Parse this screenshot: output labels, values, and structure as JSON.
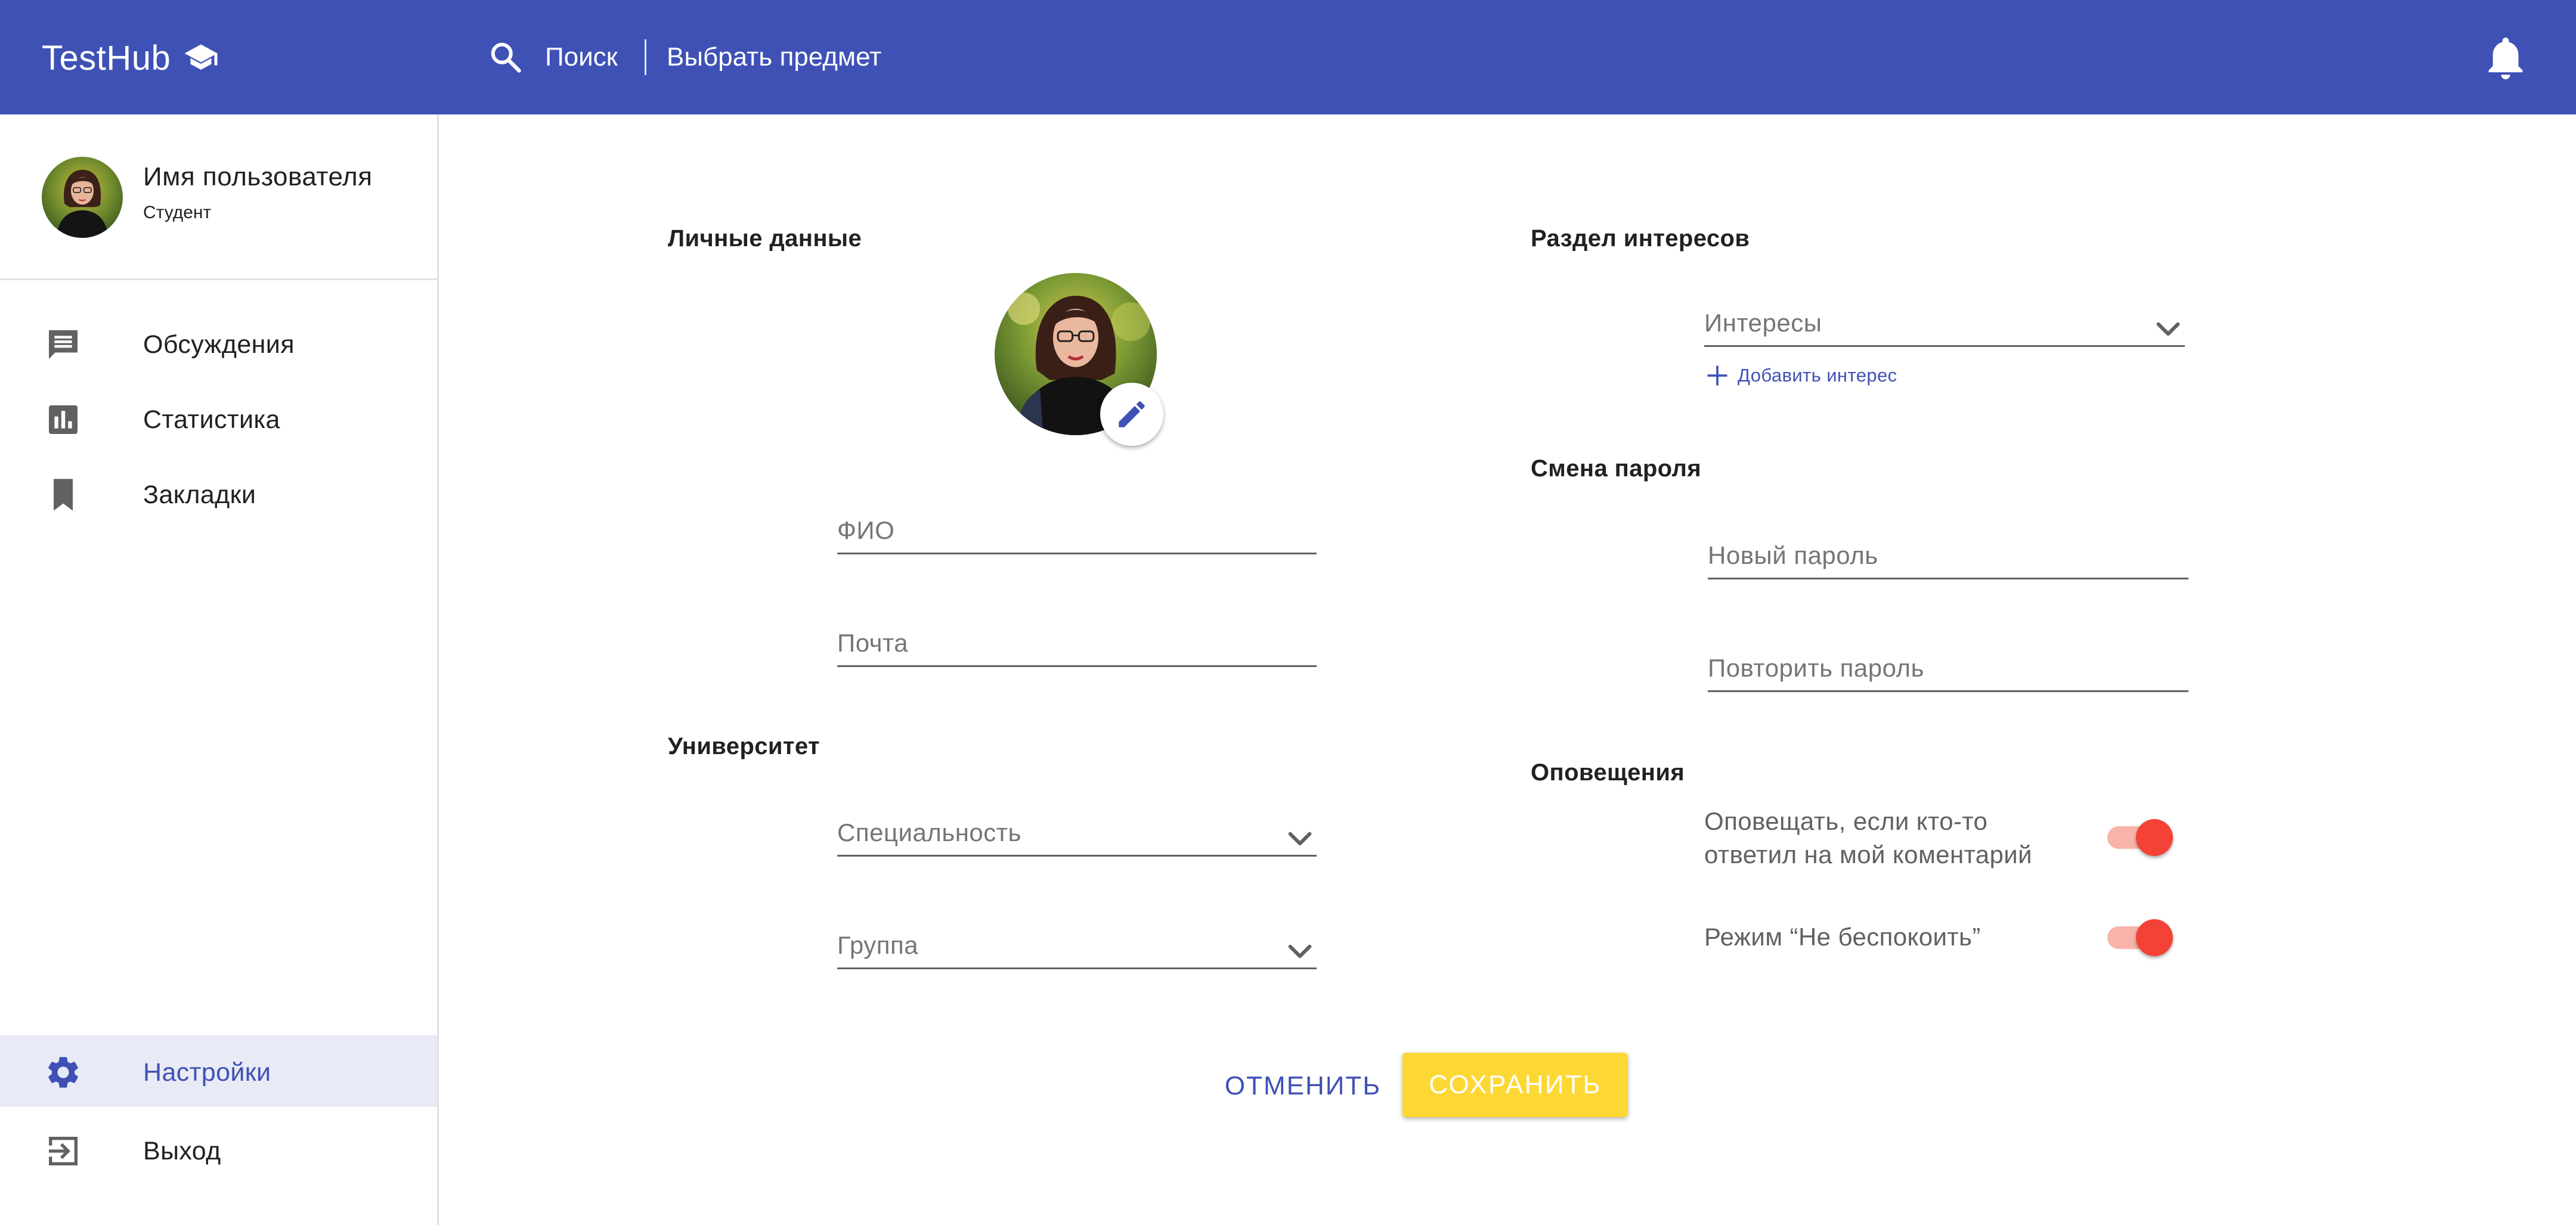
{
  "app": {
    "brand": "TestHub",
    "brand_icon": "graduation-cap-icon",
    "accent_color": "#3f51b5"
  },
  "topbar": {
    "search_label": "Поиск",
    "subject_label": "Выбрать предмет",
    "notifications_icon": "bell-icon"
  },
  "profile": {
    "name": "Имя пользователя",
    "role": "Студент"
  },
  "sidebar": {
    "items": [
      {
        "label": "Обсуждения",
        "icon": "chat-icon"
      },
      {
        "label": "Статистика",
        "icon": "bar-chart-icon"
      },
      {
        "label": "Закладки",
        "icon": "bookmark-icon"
      }
    ],
    "bottom_items": [
      {
        "label": "Настройки",
        "icon": "gear-icon",
        "active": true
      },
      {
        "label": "Выход",
        "icon": "logout-icon"
      }
    ]
  },
  "personal": {
    "title": "Личные данные",
    "fio_label": "ФИО",
    "email_label": "Почта"
  },
  "university": {
    "title": "Университет",
    "specialty_label": "Специальность",
    "group_label": "Группа"
  },
  "interests": {
    "title": "Раздел интересов",
    "select_label": "Интересы",
    "add_label": "Добавить интерес"
  },
  "password": {
    "title": "Смена пароля",
    "new_label": "Новый пароль",
    "repeat_label": "Повторить пароль"
  },
  "notifications": {
    "title": "Оповещения",
    "reply_line1": "Оповещать, если кто-то",
    "reply_line2": "ответил на мой коментарий",
    "reply_enabled": true,
    "dnd_label": "Режим “Не беспокоить”",
    "dnd_enabled": true,
    "toggle_color": "#f44336"
  },
  "actions": {
    "cancel_label": "ОТМЕНИТЬ",
    "save_label": "СОХРАНИТЬ",
    "save_color": "#fdd835"
  }
}
